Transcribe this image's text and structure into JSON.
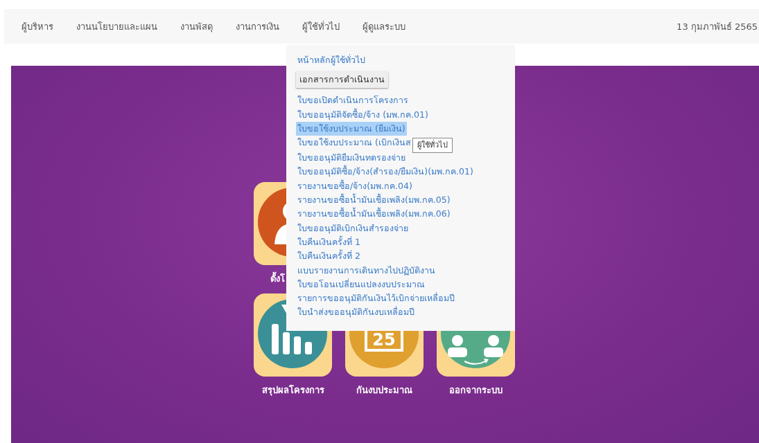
{
  "nav": {
    "items": [
      {
        "label": "ผู้บริหาร"
      },
      {
        "label": "งานนโยบายและแผน"
      },
      {
        "label": "งานพัสดุ"
      },
      {
        "label": "งานการเงิน"
      },
      {
        "label": "ผู้ใช้ทั่วไป"
      },
      {
        "label": "ผู้ดูแลระบบ"
      }
    ],
    "date": "13 กุมภาพันธ์ 2565"
  },
  "tiles_row_1": [
    {
      "label": "ตั้งโ",
      "kind": "person"
    }
  ],
  "tiles_row_2": [
    {
      "label": "สรุปผลโครงการ",
      "kind": "chart"
    },
    {
      "label": "กันงบประมาณ",
      "kind": "calendar",
      "icon_text": "25"
    },
    {
      "label": "ออกจากระบบ",
      "kind": "people"
    }
  ],
  "dropdown": {
    "home_link": "หน้าหลักผู้ใช้ทั่วไป",
    "section_button": "เอกสารการดำเนินงาน",
    "items": [
      {
        "label": "ใบขอเปิดดำเนินการโครงการ",
        "selected": false
      },
      {
        "label": "ใบขออนุมัติจัดซื้อ/จ้าง (มพ.กค.01)",
        "selected": false
      },
      {
        "label": "ใบขอใช้งบประมาณ (ยืมเงิน)",
        "selected": true
      },
      {
        "label": "ใบขอใช้งบประมาณ (เบิกเงินส",
        "selected": false,
        "tooltip": "ผู้ใช้ทั่วไป"
      },
      {
        "label": "ใบขออนุมัติยืมเงินทดรองจ่าย",
        "selected": false
      },
      {
        "label": "ใบขออนุมัติซื้อ/จ้าง(สำรอง/ยืมเงิน)(มพ.กค.01)",
        "selected": false
      },
      {
        "label": "รายงานขอซื้อ/จ้าง(มพ.กค.04)",
        "selected": false
      },
      {
        "label": "รายงานขอซื้อน้ำมันเชื้อเพลิง(มพ.กค.05)",
        "selected": false
      },
      {
        "label": "รายงานขอซื้อน้ำมันเชื้อเพลิง(มพ.กค.06)",
        "selected": false
      },
      {
        "label": "ใบขออนุมัติเบิกเงินสำรองจ่าย",
        "selected": false
      },
      {
        "label": "ใบคืนเงินครั้งที่ 1",
        "selected": false
      },
      {
        "label": "ใบคืนเงินครั้งที่ 2",
        "selected": false
      },
      {
        "label": "แบบรายงานการเดินทางไปปฏิบัติงาน",
        "selected": false
      },
      {
        "label": "ใบขอโอนเปลี่ยนแปลงงบประมาณ",
        "selected": false
      },
      {
        "label": "รายการขออนุมัติกันเงินไว้เบิกจ่ายเหลื่อมปี",
        "selected": false
      },
      {
        "label": "ใบนำส่งขออนุมัติกันงบเหลื่อมปี",
        "selected": false
      }
    ]
  }
}
